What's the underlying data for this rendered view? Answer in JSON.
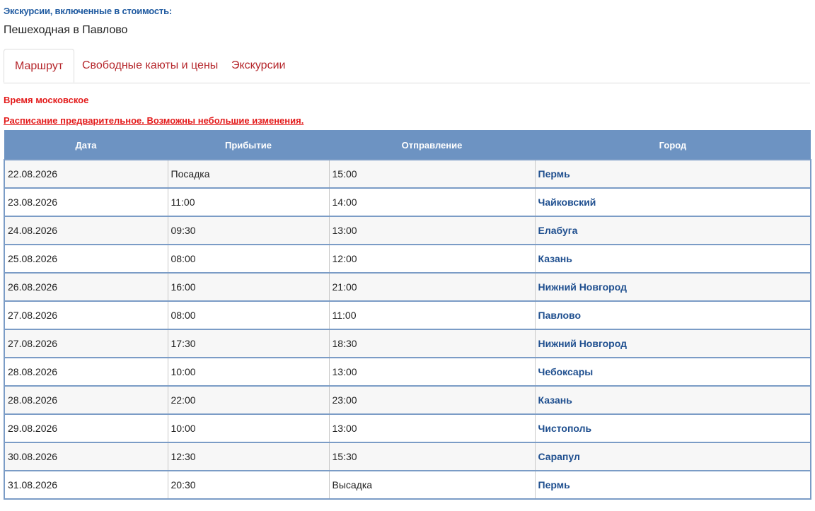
{
  "excursions": {
    "heading": "Экскурсии, включенные в стоимость:",
    "items": [
      "Пешеходная в Павлово"
    ]
  },
  "tabs": [
    {
      "label": "Маршрут",
      "active": true
    },
    {
      "label": "Свободные каюты и цены",
      "active": false
    },
    {
      "label": "Экскурсии",
      "active": false
    }
  ],
  "notices": {
    "timezone": "Время московское",
    "preliminary": "Расписание предварительное. Возможны небольшие изменения."
  },
  "colors": {
    "tab_text": "#b5262b",
    "notice_red": "#e31b1b",
    "header_bg": "#6d93c2",
    "city_link": "#1f4f8f"
  },
  "table": {
    "headers": [
      "Дата",
      "Прибытие",
      "Отправление",
      "Город"
    ],
    "rows": [
      {
        "date": "22.08.2026",
        "arrival": "Посадка",
        "departure": "15:00",
        "city": "Пермь"
      },
      {
        "date": "23.08.2026",
        "arrival": "11:00",
        "departure": "14:00",
        "city": "Чайковский"
      },
      {
        "date": "24.08.2026",
        "arrival": "09:30",
        "departure": "13:00",
        "city": "Елабуга"
      },
      {
        "date": "25.08.2026",
        "arrival": "08:00",
        "departure": "12:00",
        "city": "Казань"
      },
      {
        "date": "26.08.2026",
        "arrival": "16:00",
        "departure": "21:00",
        "city": "Нижний Новгород"
      },
      {
        "date": "27.08.2026",
        "arrival": "08:00",
        "departure": "11:00",
        "city": "Павлово"
      },
      {
        "date": "27.08.2026",
        "arrival": "17:30",
        "departure": "18:30",
        "city": "Нижний Новгород"
      },
      {
        "date": "28.08.2026",
        "arrival": "10:00",
        "departure": "13:00",
        "city": "Чебоксары"
      },
      {
        "date": "28.08.2026",
        "arrival": "22:00",
        "departure": "23:00",
        "city": "Казань"
      },
      {
        "date": "29.08.2026",
        "arrival": "10:00",
        "departure": "13:00",
        "city": "Чистополь"
      },
      {
        "date": "30.08.2026",
        "arrival": "12:30",
        "departure": "15:30",
        "city": "Сарапул"
      },
      {
        "date": "31.08.2026",
        "arrival": "20:30",
        "departure": "Высадка",
        "city": "Пермь"
      }
    ]
  }
}
